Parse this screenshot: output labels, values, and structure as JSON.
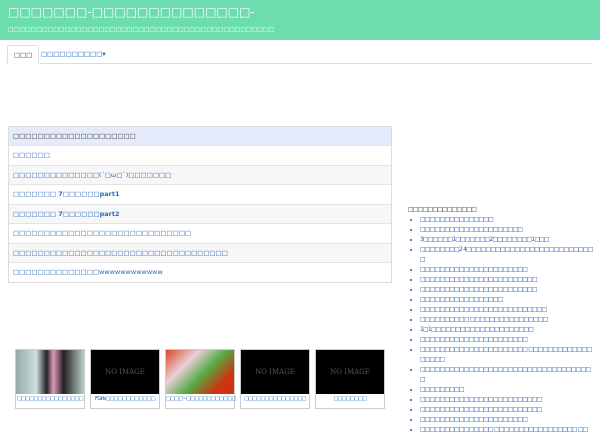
{
  "header": {
    "title": "□□□□□□□-□□□□□□□□□□□□□□-",
    "subtitle": "□□□□□□□□□□□□□□□□□□□□□□□□□□□□□□□□□□□□□□□□□□□□□□□"
  },
  "tabs": [
    {
      "label": "□□□"
    },
    {
      "label": "□□□□□□□□□□▾"
    }
  ],
  "ranking": {
    "header": "□□□□□□□□□□□□□□□□□□□□",
    "items": [
      "□□□□□□",
      "□□□□□□□□□□□□□□(´□ω□`)□□□□□□□",
      "□□□□□□□ 7□□□□□□part1",
      "□□□□□□□ 7□□□□□□part2",
      "□□□□□□□□□□□□□□□□□□□□□□□□□□□□□",
      "□□□□□□□□□□□□□□□□□□□□□□□□□□□□□□□□□□□",
      "□□□□□□□□□□□□□□wwwwwwwwwwww"
    ]
  },
  "sidebar": {
    "heading": "□□□□□□□□□□□□□□",
    "items": [
      "□□□□□□□□□□□□□□□",
      "□□□□□□□□□□□□□□□□□□□□□",
      "3□□□□□□1□□□□□□□2□□□□□□□□1□□□",
      "□□□□□□□□2 4□□□□□□□□□□□□□□□□□□□□□□□□□□□",
      "□□□□□□□□□□□□□□□□□□□□□□",
      "□□□□□□□□□□□□□□□□□□□□□□□□",
      "□□□□□□□□□□□□□□□□□□□□□□□□",
      "□□□□□□□□□□□□□□□□□",
      "□□□□□□□□□□□□□□□□□□□□□□□□□□",
      "□□□□□□□□□□ □□□□□□□□□□□□□□□□",
      "1□1□□□□□□□□□□□□□□□□□□□□□",
      "□□□□□□□□□□□□□□□□□□□□□□",
      "□□□□□□□□□□□□□□□□□□□□□□ □□□□□□□□□□□□□□□□□□",
      "□□□□□□□□□□□□□□□□□□□□□□□□□□□□□□□□□□□□",
      "□□□□□□□□□",
      "□□□□□□□□□□□□□□□□□□□□□□□□□",
      "□□□□□□□□□□□□□□□□□□□□□□□□□",
      "□□□□□□□□□□□□□□□□□□□□□□",
      "□□□□□□□□□□□□□□□ □□□□□□□□□□□□□□□□□ □□"
    ]
  },
  "thumbs": [
    {
      "image": "photo",
      "caption": "□□□□□□□□□□□□□□□□"
    },
    {
      "image": "NO IMAGE",
      "caption": "FGirls□□□□□□□□□□□□"
    },
    {
      "image": "illustration",
      "caption": "□□□□~□□□□□□□□□□□□"
    },
    {
      "image": "NO IMAGE",
      "caption": "□□□□□□□□□□□□□□□"
    },
    {
      "image": "NO IMAGE",
      "caption": "□□□□□□□□"
    }
  ]
}
